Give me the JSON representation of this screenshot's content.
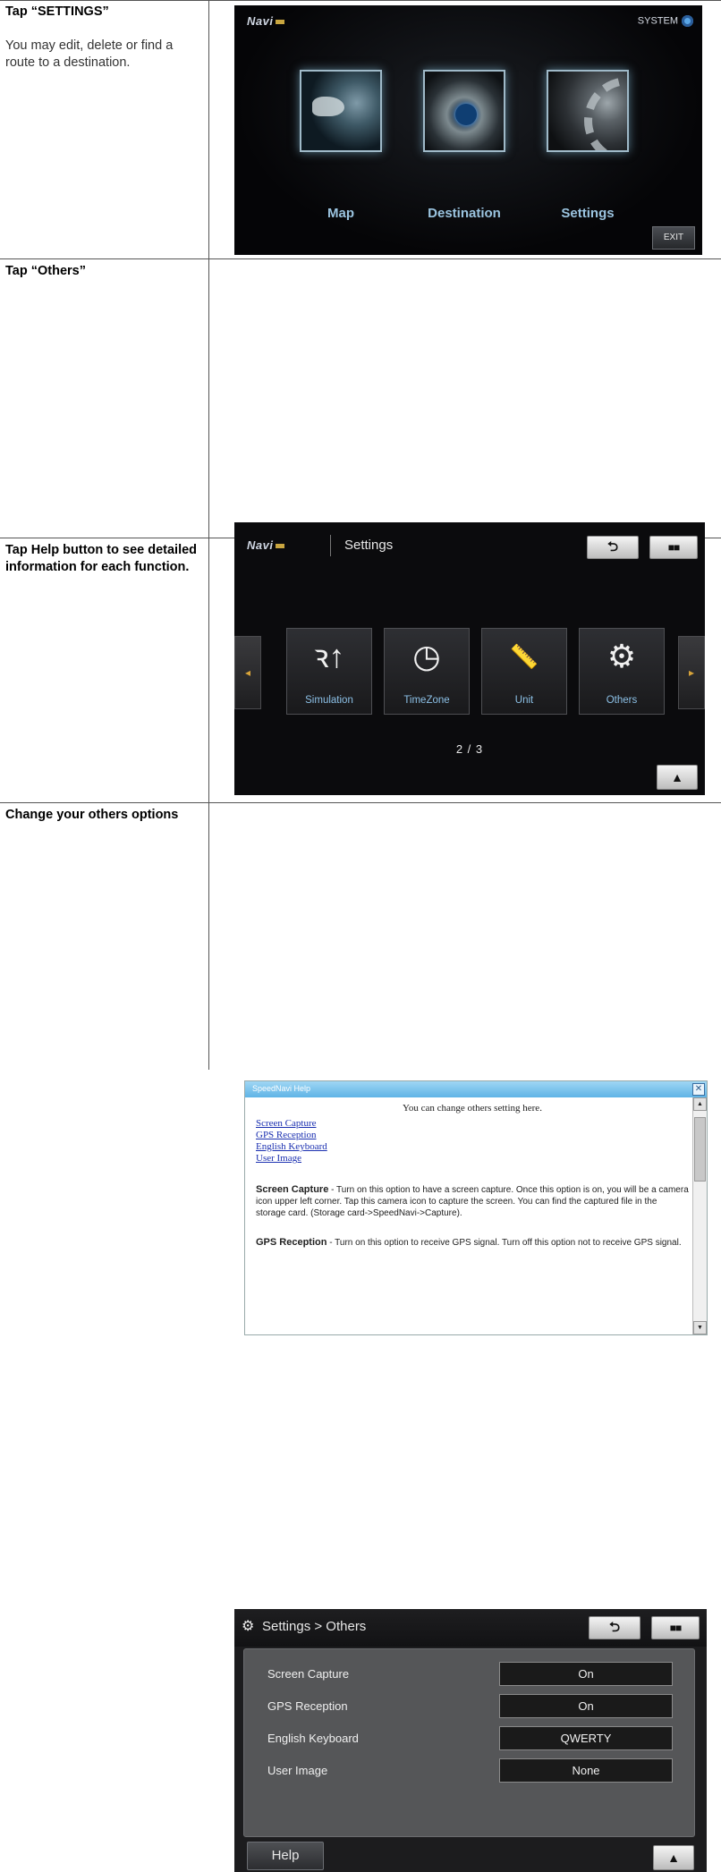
{
  "steps": [
    {
      "title": "Tap “SETTINGS”",
      "description": "You may edit, delete or find a route to a destination."
    },
    {
      "title": "Tap “Others”",
      "description": ""
    },
    {
      "title": "Tap Help button to see detailed information for each function.",
      "description": ""
    },
    {
      "title": "Change your others options",
      "description": ""
    }
  ],
  "screen_main": {
    "logo": "Navi",
    "system_label": "SYSTEM",
    "tiles": [
      "Map",
      "Destination",
      "Settings"
    ],
    "exit_label": "EXIT"
  },
  "screen_settings": {
    "logo": "Navi",
    "title": "Settings",
    "back_symbol": "⮌",
    "options": [
      {
        "label": "Simulation",
        "icon": "simulation-icon"
      },
      {
        "label": "TimeZone",
        "icon": "clock-icon"
      },
      {
        "label": "Unit",
        "icon": "ruler-icon"
      },
      {
        "label": "Others",
        "icon": "gears-icon"
      }
    ],
    "page": "2 / 3",
    "prev_symbol": "◂",
    "next_symbol": "▸",
    "up_symbol": "▲"
  },
  "screen_help": {
    "title": "SpeedNavi Help",
    "close_symbol": "✕",
    "intro": "You can change others setting here.",
    "links": [
      "Screen Capture",
      "GPS Reception",
      "English Keyboard",
      "User Image"
    ],
    "paragraphs": [
      {
        "term": "Screen Capture",
        "text": " - Turn on this option to have a screen capture. Once this option is on, you will be a camera icon upper left corner. Tap this camera icon to capture the screen. You can find the captured file in the storage card. (Storage card->SpeedNavi->Capture)."
      },
      {
        "term": "GPS Reception",
        "text": " - Turn on this option to receive GPS signal. Turn off this option not to receive GPS signal."
      }
    ]
  },
  "screen_others": {
    "title": "Settings > Others",
    "back_symbol": "⮌",
    "rows": [
      {
        "name": "Screen Capture",
        "value": "On"
      },
      {
        "name": "GPS Reception",
        "value": "On"
      },
      {
        "name": "English Keyboard",
        "value": "QWERTY"
      },
      {
        "name": "User Image",
        "value": "None"
      }
    ],
    "help_label": "Help",
    "up_symbol": "▲"
  }
}
